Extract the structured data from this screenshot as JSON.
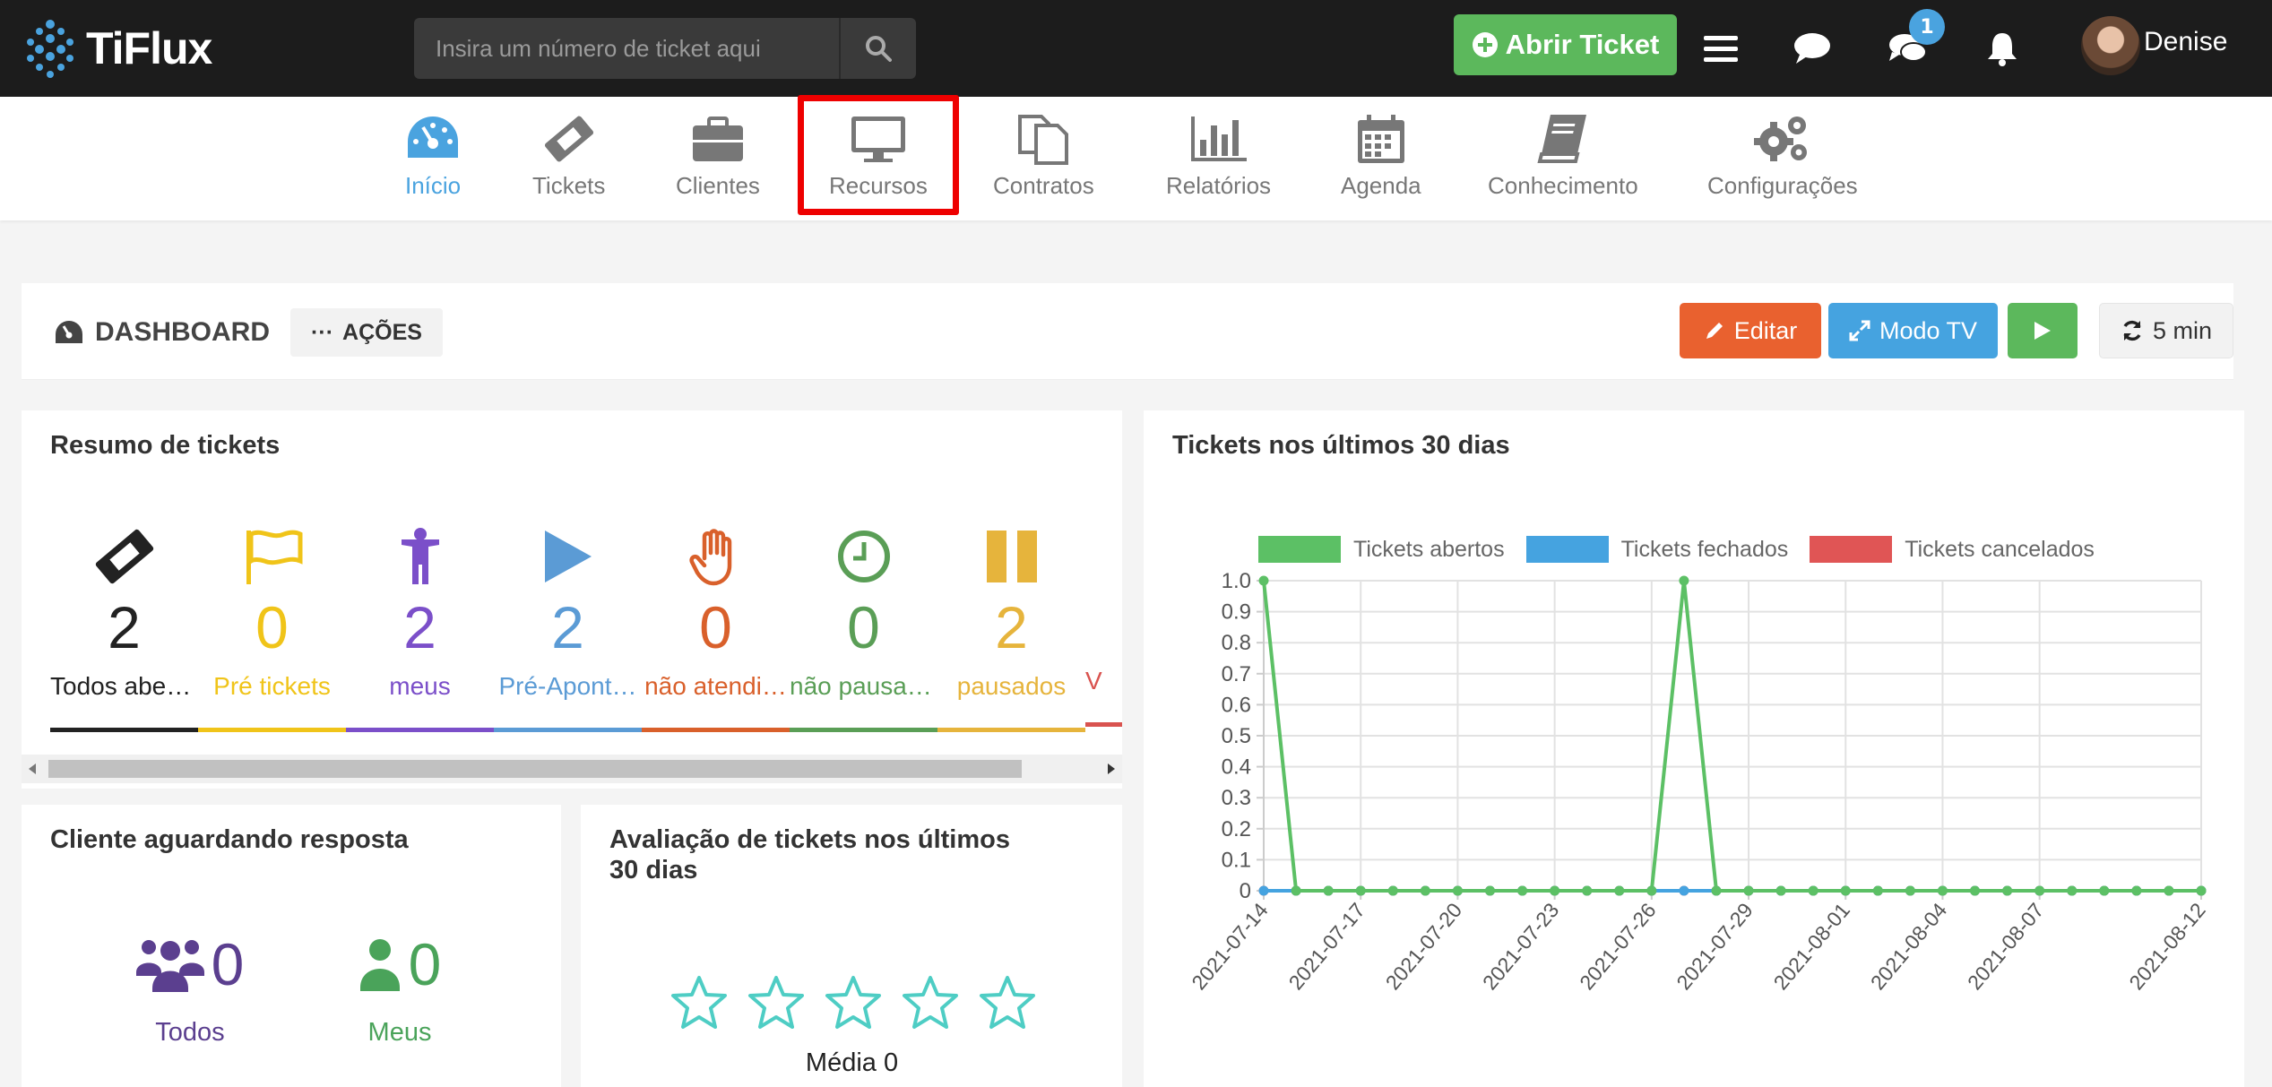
{
  "app": {
    "brand": "TiFlux",
    "user_name": "Denise"
  },
  "search": {
    "placeholder": "Insira um número de ticket aqui"
  },
  "header": {
    "open_ticket_label": "Abrir Ticket",
    "chat_badge": "1"
  },
  "nav": {
    "items": [
      {
        "label": "Início",
        "icon": "speedometer-icon",
        "active": true
      },
      {
        "label": "Tickets",
        "icon": "ticket-icon"
      },
      {
        "label": "Clientes",
        "icon": "briefcase-icon"
      },
      {
        "label": "Recursos",
        "icon": "monitor-icon",
        "highlighted": true
      },
      {
        "label": "Contratos",
        "icon": "documents-icon"
      },
      {
        "label": "Relatórios",
        "icon": "bar-chart-icon"
      },
      {
        "label": "Agenda",
        "icon": "calendar-icon"
      },
      {
        "label": "Conhecimento",
        "icon": "book-icon"
      },
      {
        "label": "Configurações",
        "icon": "gears-icon"
      }
    ]
  },
  "dashboard": {
    "title": "DASHBOARD",
    "actions_label": "AÇÕES",
    "edit_label": "Editar",
    "tv_label": "Modo TV",
    "refresh_label": "5 min"
  },
  "summary": {
    "title": "Resumo de tickets",
    "items": [
      {
        "value": "2",
        "label": "Todos aber…",
        "color": "#222222"
      },
      {
        "value": "0",
        "label": "Pré tickets",
        "color": "#f0c419"
      },
      {
        "value": "2",
        "label": "meus",
        "color": "#7b4fc9"
      },
      {
        "value": "2",
        "label": "Pré-Apont…",
        "color": "#5b9bd5"
      },
      {
        "value": "0",
        "label": "não atendi…",
        "color": "#d9602b"
      },
      {
        "value": "0",
        "label": "não pausad…",
        "color": "#5a9e56"
      },
      {
        "value": "2",
        "label": "pausados",
        "color": "#e6b43c"
      },
      {
        "value": "",
        "label": "V",
        "color": "#d9534f"
      }
    ]
  },
  "cliente": {
    "title": "Cliente aguardando resposta",
    "todos_value": "0",
    "todos_label": "Todos",
    "meus_value": "0",
    "meus_label": "Meus"
  },
  "avaliacao": {
    "title_line1": "Avaliação de tickets nos últimos",
    "title_line2": "30 dias",
    "rating": 0,
    "media_label": "Média 0"
  },
  "chart_panel": {
    "title": "Tickets nos últimos 30 dias"
  },
  "chart_data": {
    "type": "line",
    "title": "Tickets nos últimos 30 dias",
    "x": [
      "2021-07-14",
      "2021-07-15",
      "2021-07-16",
      "2021-07-17",
      "2021-07-18",
      "2021-07-19",
      "2021-07-20",
      "2021-07-21",
      "2021-07-22",
      "2021-07-23",
      "2021-07-24",
      "2021-07-25",
      "2021-07-26",
      "2021-07-27",
      "2021-07-28",
      "2021-07-29",
      "2021-07-30",
      "2021-07-31",
      "2021-08-01",
      "2021-08-02",
      "2021-08-03",
      "2021-08-04",
      "2021-08-05",
      "2021-08-06",
      "2021-08-07",
      "2021-08-08",
      "2021-08-09",
      "2021-08-10",
      "2021-08-11",
      "2021-08-12"
    ],
    "x_tick_labels": [
      "2021-07-14",
      "2021-07-17",
      "2021-07-20",
      "2021-07-23",
      "2021-07-26",
      "2021-07-29",
      "2021-08-01",
      "2021-08-04",
      "2021-08-07",
      "2021-08-12"
    ],
    "y_tick_labels": [
      "0",
      "0.1",
      "0.2",
      "0.3",
      "0.4",
      "0.5",
      "0.6",
      "0.7",
      "0.8",
      "0.9",
      "1.0"
    ],
    "ylim": [
      0,
      1
    ],
    "grid": true,
    "legend_position": "top",
    "series": [
      {
        "name": "Tickets abertos",
        "color": "#5cc065",
        "values": [
          1,
          0,
          0,
          0,
          0,
          0,
          0,
          0,
          0,
          0,
          0,
          0,
          0,
          1,
          0,
          0,
          0,
          0,
          0,
          0,
          0,
          0,
          0,
          0,
          0,
          0,
          0,
          0,
          0,
          0
        ]
      },
      {
        "name": "Tickets fechados",
        "color": "#45a3e0",
        "values": [
          0,
          0,
          0,
          0,
          0,
          0,
          0,
          0,
          0,
          0,
          0,
          0,
          0,
          0,
          0,
          0,
          0,
          0,
          0,
          0,
          0,
          0,
          0,
          0,
          0,
          0,
          0,
          0,
          0,
          0
        ]
      },
      {
        "name": "Tickets cancelados",
        "color": "#e05555",
        "values": [
          0,
          0,
          0,
          0,
          0,
          0,
          0,
          0,
          0,
          0,
          0,
          0,
          0,
          0,
          0,
          0,
          0,
          0,
          0,
          0,
          0,
          0,
          0,
          0,
          0,
          0,
          0,
          0,
          0,
          0
        ]
      }
    ]
  }
}
